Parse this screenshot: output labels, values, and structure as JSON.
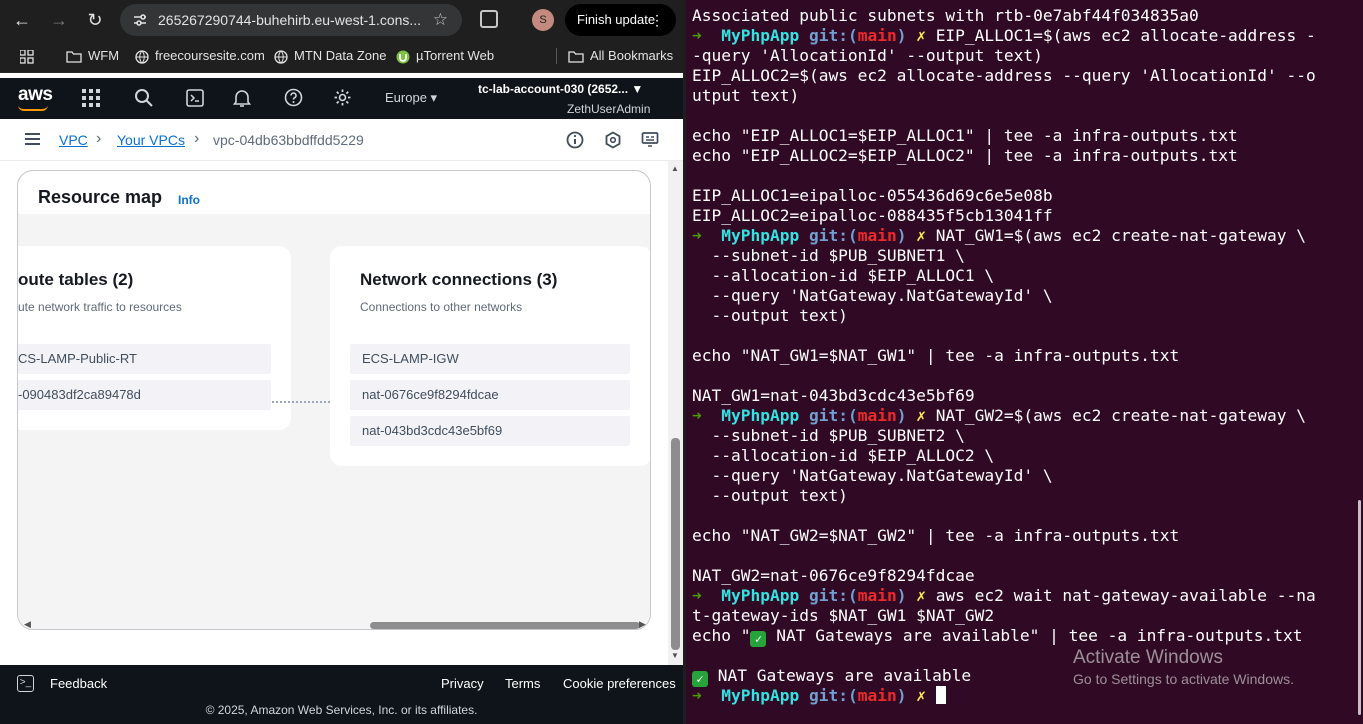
{
  "browser": {
    "url": "265267290744-buhehirb.eu-west-1.cons...",
    "finish_update": "Finish update",
    "profile_initial": "S"
  },
  "bookmarks": [
    "WFM",
    "freecoursesite.com",
    "MTN Data Zone",
    "µTorrent Web",
    "All Bookmarks"
  ],
  "aws": {
    "logo": "aws",
    "region": "Europe",
    "account": "tc-lab-account-030 (2652...",
    "user": "ZethUserAdmin"
  },
  "breadcrumb": {
    "vpc": "VPC",
    "your_vpcs": "Your VPCs",
    "current": "vpc-04db63bbdffdd5229"
  },
  "resource_map": {
    "title": "Resource map",
    "info": "Info",
    "route_tables": {
      "title": "oute tables (2)",
      "subtitle": "ute network traffic to resources",
      "items": [
        "CS-LAMP-Public-RT",
        "-090483df2ca89478d"
      ]
    },
    "network_connections": {
      "title": "Network connections (3)",
      "subtitle": "Connections to other networks",
      "items": [
        "ECS-LAMP-IGW",
        "nat-0676ce9f8294fdcae",
        "nat-043bd3cdc43e5bf69"
      ]
    }
  },
  "footer": {
    "feedback": "Feedback",
    "privacy": "Privacy",
    "terms": "Terms",
    "cookies": "Cookie preferences",
    "copyright": "© 2025, Amazon Web Services, Inc. or its affiliates."
  },
  "terminal": {
    "prompt": {
      "arrow": "➜",
      "dir": "MyPhpApp",
      "git": "git:(",
      "branch": "main",
      "close": ")",
      "x": "✗"
    },
    "lines": [
      {
        "t": "out",
        "text": "Associated public subnets with rtb-0e7abf44f034835a0"
      },
      {
        "t": "cmd",
        "text": "EIP_ALLOC1=$(aws ec2 allocate-address -"
      },
      {
        "t": "out",
        "text": "-query 'AllocationId' --output text)"
      },
      {
        "t": "out",
        "text": "EIP_ALLOC2=$(aws ec2 allocate-address --query 'AllocationId' --o"
      },
      {
        "t": "out",
        "text": "utput text)"
      },
      {
        "t": "out",
        "text": ""
      },
      {
        "t": "out",
        "text": "echo \"EIP_ALLOC1=$EIP_ALLOC1\" | tee -a infra-outputs.txt"
      },
      {
        "t": "out",
        "text": "echo \"EIP_ALLOC2=$EIP_ALLOC2\" | tee -a infra-outputs.txt"
      },
      {
        "t": "out",
        "text": ""
      },
      {
        "t": "out",
        "text": "EIP_ALLOC1=eipalloc-055436d69c6e5e08b"
      },
      {
        "t": "out",
        "text": "EIP_ALLOC2=eipalloc-088435f5cb13041ff"
      },
      {
        "t": "cmd",
        "text": "NAT_GW1=$(aws ec2 create-nat-gateway \\"
      },
      {
        "t": "out",
        "text": "  --subnet-id $PUB_SUBNET1 \\"
      },
      {
        "t": "out",
        "text": "  --allocation-id $EIP_ALLOC1 \\"
      },
      {
        "t": "out",
        "text": "  --query 'NatGateway.NatGatewayId' \\"
      },
      {
        "t": "out",
        "text": "  --output text)"
      },
      {
        "t": "out",
        "text": ""
      },
      {
        "t": "out",
        "text": "echo \"NAT_GW1=$NAT_GW1\" | tee -a infra-outputs.txt"
      },
      {
        "t": "out",
        "text": ""
      },
      {
        "t": "out",
        "text": "NAT_GW1=nat-043bd3cdc43e5bf69"
      },
      {
        "t": "cmd",
        "text": "NAT_GW2=$(aws ec2 create-nat-gateway \\"
      },
      {
        "t": "out",
        "text": "  --subnet-id $PUB_SUBNET2 \\"
      },
      {
        "t": "out",
        "text": "  --allocation-id $EIP_ALLOC2 \\"
      },
      {
        "t": "out",
        "text": "  --query 'NatGateway.NatGatewayId' \\"
      },
      {
        "t": "out",
        "text": "  --output text)"
      },
      {
        "t": "out",
        "text": ""
      },
      {
        "t": "out",
        "text": "echo \"NAT_GW2=$NAT_GW2\" | tee -a infra-outputs.txt"
      },
      {
        "t": "out",
        "text": ""
      },
      {
        "t": "out",
        "text": "NAT_GW2=nat-0676ce9f8294fdcae"
      },
      {
        "t": "cmd",
        "text": "aws ec2 wait nat-gateway-available --na"
      },
      {
        "t": "out",
        "text": "t-gateway-ids $NAT_GW1 $NAT_GW2"
      },
      {
        "t": "chk",
        "pre": "echo \"",
        "text": " NAT Gateways are available\" | tee -a infra-outputs.txt"
      },
      {
        "t": "out",
        "text": ""
      },
      {
        "t": "chk",
        "pre": "",
        "text": " NAT Gateways are available"
      },
      {
        "t": "prompt",
        "text": ""
      }
    ],
    "watermark_title": "Activate Windows",
    "watermark_sub": "Go to Settings to activate Windows."
  }
}
